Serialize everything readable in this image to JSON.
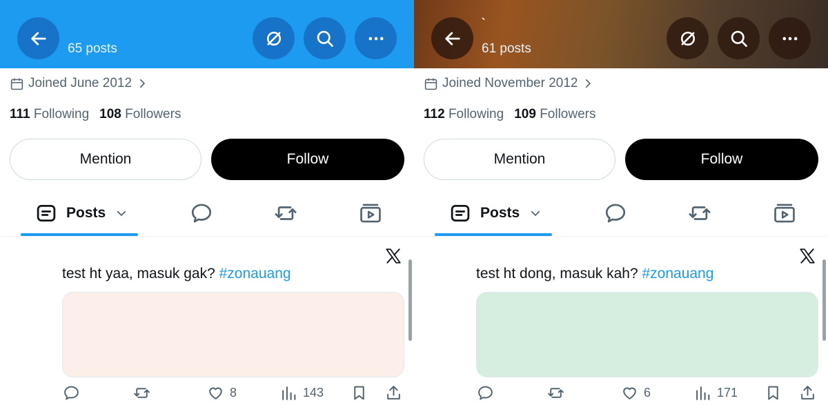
{
  "panels": [
    {
      "header": {
        "name": "",
        "post_count": "65 posts",
        "color": "#1d9bf0"
      },
      "joined": "Joined June 2012",
      "following_count": "111",
      "following_label": "Following",
      "followers_count": "108",
      "followers_label": "Followers",
      "buttons": {
        "mention": "Mention",
        "follow": "Follow"
      },
      "tabs": {
        "posts": "Posts"
      },
      "tweet": {
        "text": "test ht yaa, masuk gak? ",
        "hashtag": "#zonauang",
        "media_color": "#fcefea",
        "likes": "8",
        "views": "143"
      }
    },
    {
      "header": {
        "name": "`",
        "post_count": "61 posts",
        "color": "#6f3a19"
      },
      "joined": "Joined November 2012",
      "following_count": "112",
      "following_label": "Following",
      "followers_count": "109",
      "followers_label": "Followers",
      "buttons": {
        "mention": "Mention",
        "follow": "Follow"
      },
      "tabs": {
        "posts": "Posts"
      },
      "tweet": {
        "text": "test ht dong, masuk kah? ",
        "hashtag": "#zonauang",
        "media_color": "#d5eee0",
        "likes": "6",
        "views": "171"
      }
    }
  ],
  "icons": {
    "back": "arrow-left-icon",
    "grok": "grok-icon",
    "search": "search-icon",
    "more": "more-icon",
    "calendar": "calendar-icon",
    "x_logo": "x-logo-icon"
  }
}
